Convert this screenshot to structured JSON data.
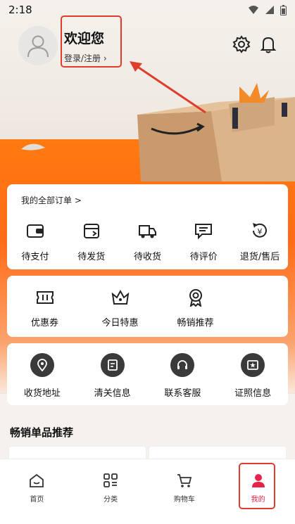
{
  "status_bar": {
    "time": "2:18"
  },
  "header": {
    "welcome_title": "欢迎您",
    "login_text": "登录/注册 ›"
  },
  "orders": {
    "heading": "我的全部订单 >",
    "items": [
      {
        "label": "待支付",
        "icon": "wallet-icon"
      },
      {
        "label": "待发货",
        "icon": "box-icon"
      },
      {
        "label": "待收货",
        "icon": "truck-icon"
      },
      {
        "label": "待评价",
        "icon": "comment-icon"
      },
      {
        "label": "退货/售后",
        "icon": "refund-icon"
      }
    ]
  },
  "promos": {
    "items": [
      {
        "label": "优惠券",
        "icon": "ticket-icon"
      },
      {
        "label": "今日特惠",
        "icon": "crown-icon"
      },
      {
        "label": "畅销推荐",
        "icon": "award-icon"
      }
    ]
  },
  "services": {
    "items": [
      {
        "label": "收货地址",
        "icon": "location-icon"
      },
      {
        "label": "清关信息",
        "icon": "document-icon"
      },
      {
        "label": "联系客服",
        "icon": "headset-icon"
      },
      {
        "label": "证照信息",
        "icon": "certificate-icon"
      }
    ]
  },
  "bestsellers": {
    "title": "畅销单品推荐"
  },
  "bottom_nav": {
    "items": [
      {
        "label": "首页",
        "icon": "home-icon",
        "active": false
      },
      {
        "label": "分类",
        "icon": "category-icon",
        "active": false
      },
      {
        "label": "购物车",
        "icon": "cart-icon",
        "active": false
      },
      {
        "label": "我的",
        "icon": "user-icon",
        "active": true
      }
    ]
  },
  "colors": {
    "accent": "#e8234a",
    "orange": "#ff7a10",
    "highlight": "#e03c2c"
  }
}
